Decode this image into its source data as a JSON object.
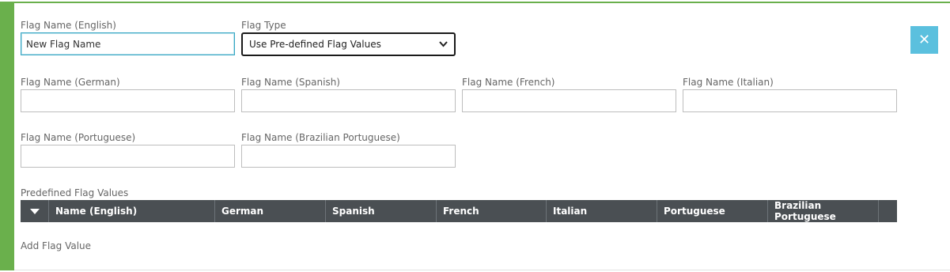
{
  "form": {
    "english": {
      "label": "Flag Name (English)",
      "value": "New Flag Name"
    },
    "flag_type": {
      "label": "Flag Type",
      "selected": "Use Pre-defined Flag Values"
    },
    "german": {
      "label": "Flag Name (German)",
      "value": ""
    },
    "spanish": {
      "label": "Flag Name (Spanish)",
      "value": ""
    },
    "french": {
      "label": "Flag Name (French)",
      "value": ""
    },
    "italian": {
      "label": "Flag Name (Italian)",
      "value": ""
    },
    "portuguese": {
      "label": "Flag Name (Portuguese)",
      "value": ""
    },
    "brazilian": {
      "label": "Flag Name (Brazilian Portuguese)",
      "value": ""
    }
  },
  "close_button": {
    "icon": "close-icon",
    "glyph": "✕"
  },
  "values_table": {
    "title": "Predefined Flag Values",
    "columns": [
      "Name (English)",
      "German",
      "Spanish",
      "French",
      "Italian",
      "Portuguese",
      "Brazilian Portuguese"
    ]
  },
  "add_value_label": "Add Flag Value",
  "colors": {
    "accent_green": "#6ab04c",
    "close_blue": "#5bc0de",
    "header_gray": "#4a4f53",
    "focus": "#36a7c4"
  }
}
